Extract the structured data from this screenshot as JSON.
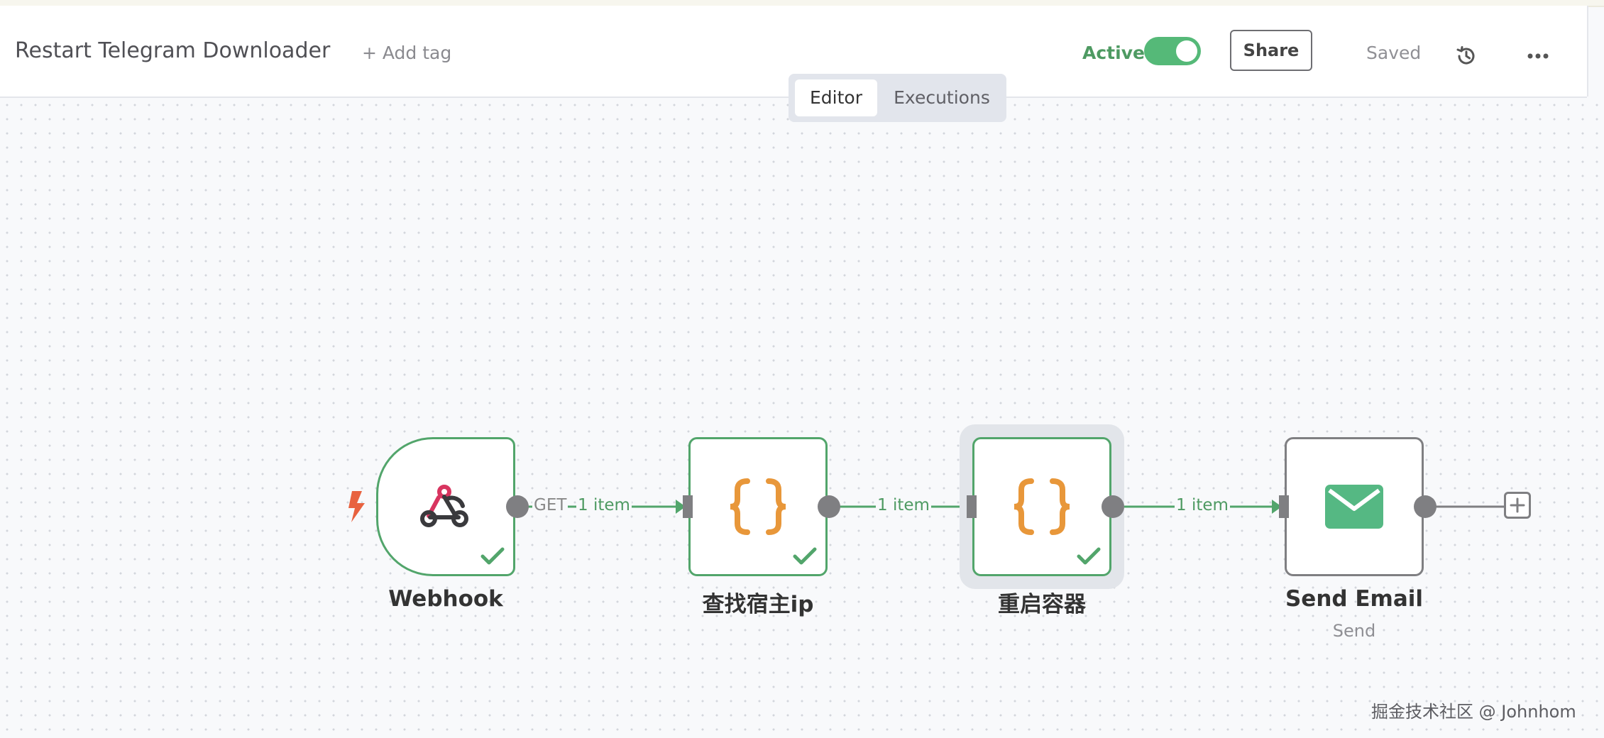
{
  "header": {
    "title": "Restart Telegram Downloader",
    "add_tag": "+ Add tag",
    "active_label": "Active",
    "active": true,
    "share": "Share",
    "saved": "Saved"
  },
  "tabs": [
    {
      "label": "Editor",
      "selected": true
    },
    {
      "label": "Executions",
      "selected": false
    }
  ],
  "nodes": [
    {
      "name": "Webhook",
      "icon": "webhook-icon",
      "status": "success"
    },
    {
      "name": "查找宿主ip",
      "icon": "code-braces-icon",
      "status": "success"
    },
    {
      "name": "重启容器",
      "icon": "code-braces-icon",
      "status": "success"
    },
    {
      "name": "Send Email",
      "subtitle": "Send",
      "icon": "envelope-icon",
      "status": "none"
    }
  ],
  "edges": [
    {
      "method": "GET",
      "label": "1 item"
    },
    {
      "label": "1 item"
    },
    {
      "label": "1 item"
    }
  ],
  "colors": {
    "success": "#52a56b",
    "accent_orange": "#e8973a",
    "email_green": "#55b883",
    "trigger": "#e8623f",
    "webhook_pink": "#d8345f"
  },
  "watermark": "掘金技术社区 @ Johnhom"
}
